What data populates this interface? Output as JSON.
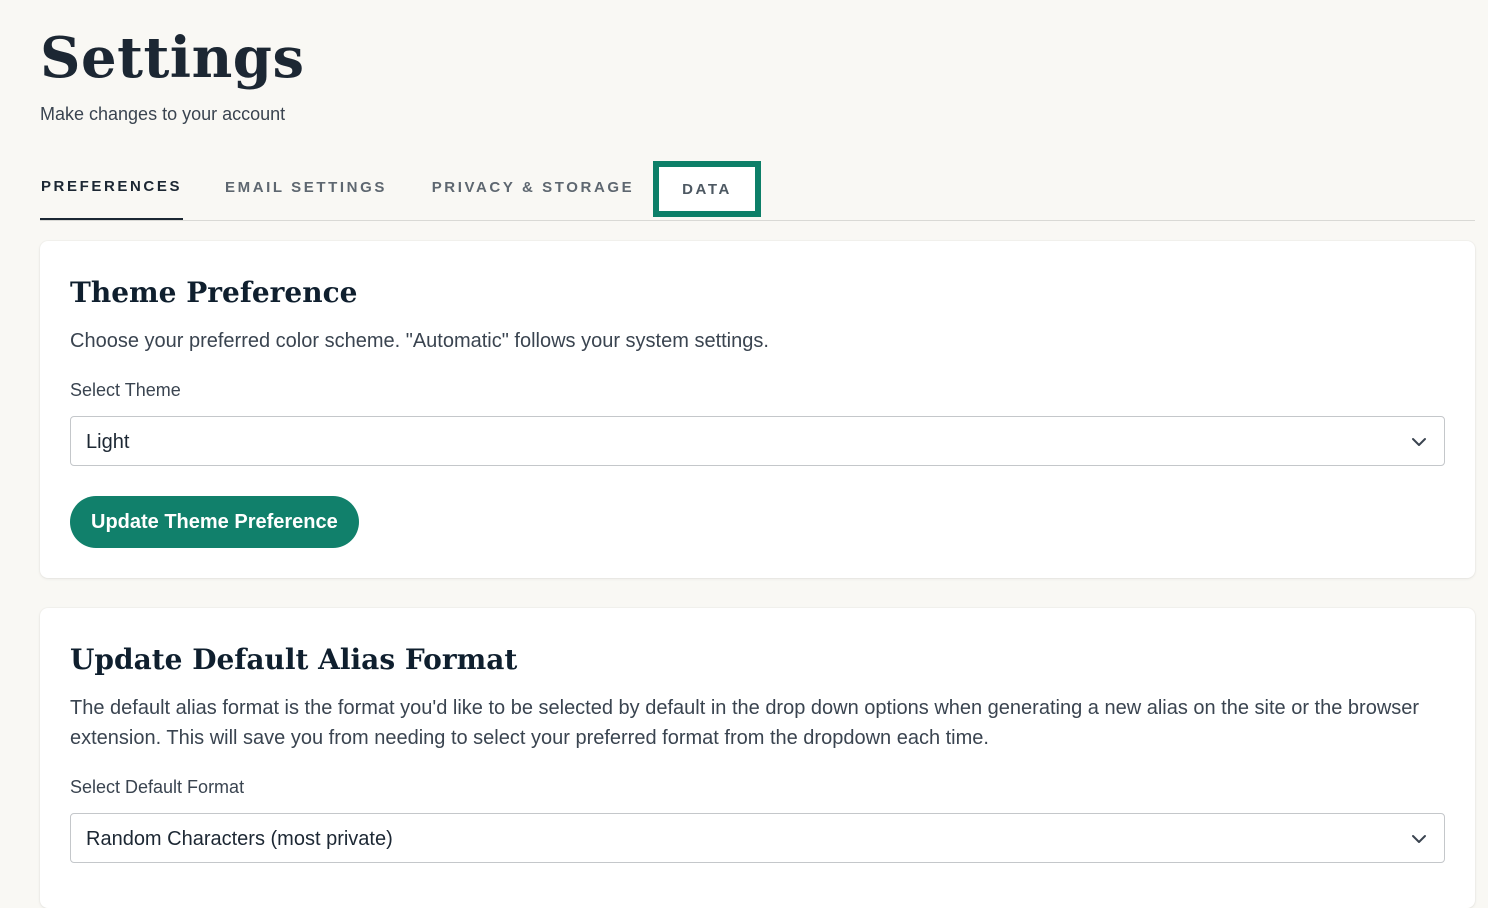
{
  "header": {
    "title": "Settings",
    "subtitle": "Make changes to your account"
  },
  "tabs": [
    {
      "label": "PREFERENCES",
      "active": true
    },
    {
      "label": "EMAIL SETTINGS",
      "active": false
    },
    {
      "label": "PRIVACY & STORAGE",
      "active": false
    },
    {
      "label": "DATA",
      "active": false,
      "highlighted": true
    }
  ],
  "theme_card": {
    "title": "Theme Preference",
    "description": "Choose your preferred color scheme. \"Automatic\" follows your system settings.",
    "select_label": "Select Theme",
    "selected_value": "Light",
    "button_label": "Update Theme Preference"
  },
  "alias_card": {
    "title": "Update Default Alias Format",
    "description": "The default alias format is the format you'd like to be selected by default in the drop down options when generating a new alias on the site or the browser extension. This will save you from needing to select your preferred format from the dropdown each time.",
    "select_label": "Select Default Format",
    "selected_value": "Random Characters (most private)"
  },
  "colors": {
    "accent": "#11806b",
    "highlight_border": "#0d7f68",
    "background": "#f9f8f4",
    "text": "#1c2733"
  },
  "icons": {
    "select_chevron": "chevron-down-icon"
  }
}
